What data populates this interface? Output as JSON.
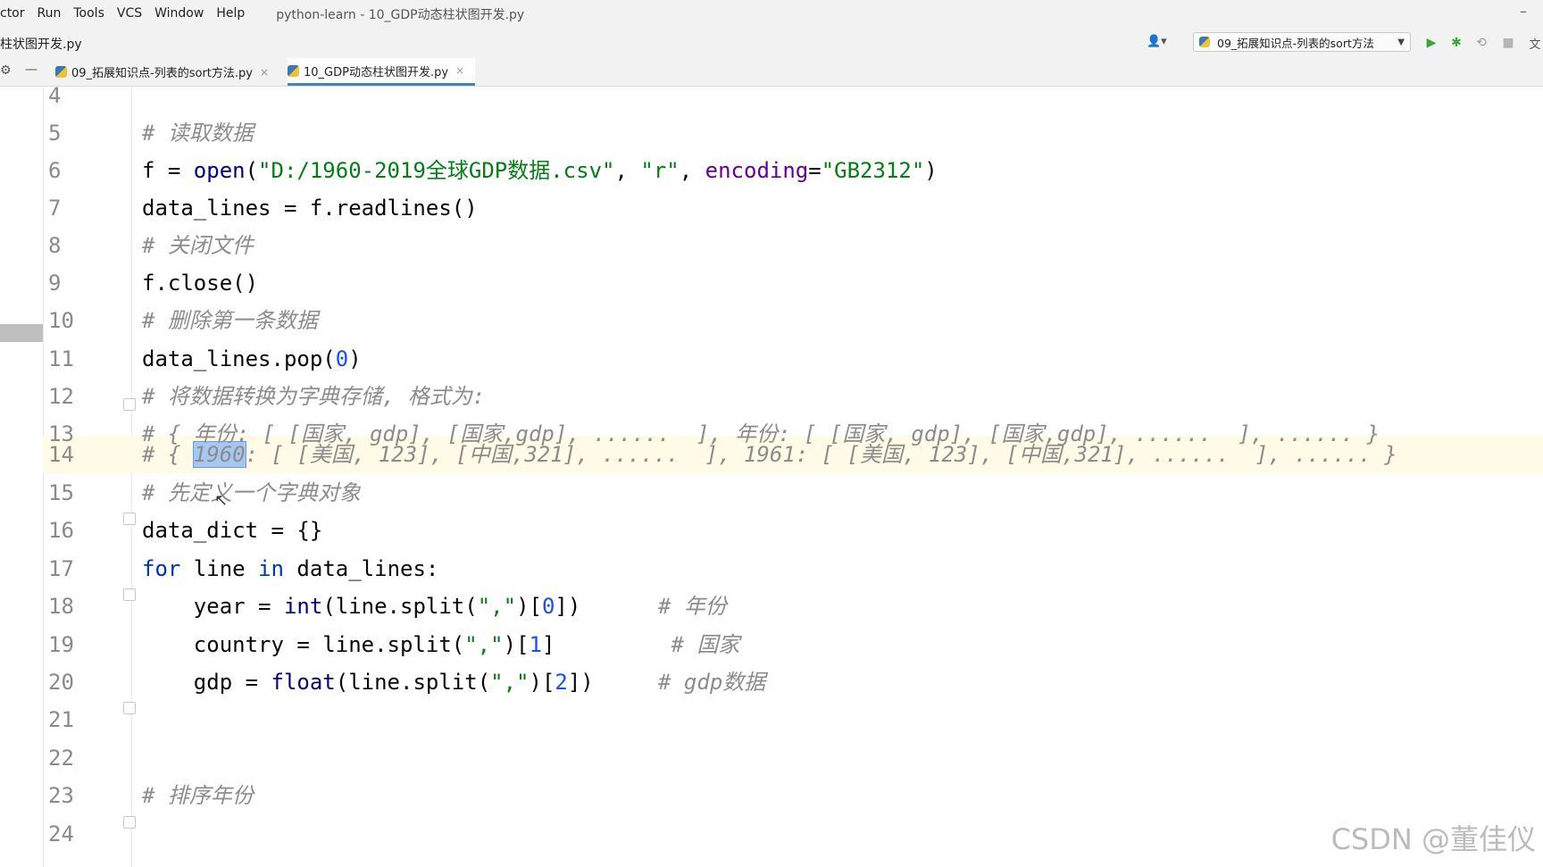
{
  "menu": {
    "items": [
      "ctor",
      "Run",
      "Tools",
      "VCS",
      "Window",
      "Help"
    ],
    "window_title": "python-learn - 10_GDP动态柱状图开发.py"
  },
  "nav": {
    "breadcrumb": "柱状图开发.py",
    "run_config": "09_拓展知识点-列表的sort方法"
  },
  "tabs": [
    {
      "label": "09_拓展知识点-列表的sort方法.py",
      "active": false
    },
    {
      "label": "10_GDP动态柱状图开发.py",
      "active": true
    }
  ],
  "editor": {
    "line_numbers": [
      "4",
      "5",
      "6",
      "7",
      "8",
      "9",
      "10",
      "11",
      "12",
      "13",
      "14",
      "15",
      "16",
      "17",
      "18",
      "19",
      "20",
      "21",
      "22",
      "23",
      "24"
    ],
    "current_line": "14",
    "selected_text": "1960",
    "lines": {
      "l5": {
        "comment": "# 读取数据"
      },
      "l6": {
        "var": "f = ",
        "fn": "open",
        "p1": "(",
        "s1": "\"D:/1960-2019全球GDP数据.csv\"",
        "c1": ", ",
        "s2": "\"r\"",
        "c2": ", ",
        "kw": "encoding",
        "eq": "=",
        "s3": "\"GB2312\"",
        "p2": ")"
      },
      "l7": {
        "code": "data_lines = f.readlines()"
      },
      "l8": {
        "comment": "# 关闭文件"
      },
      "l9": {
        "code": "f.close()"
      },
      "l10": {
        "comment": "# 删除第一条数据"
      },
      "l11": {
        "a": "data_lines.pop(",
        "n": "0",
        "b": ")"
      },
      "l12": {
        "comment": "# 将数据转换为字典存储, 格式为:"
      },
      "l13": {
        "comment": "# { 年份: [ [国家, gdp], [国家,gdp], ......  ], 年份: [ [国家, gdp], [国家,gdp], ......  ], ...... }"
      },
      "l14": {
        "pre": "# { ",
        "sel": "1960",
        "post": ": [ [美国, 123], [中国,321], ......  ], 1961: [ [美国, 123], [中国,321], ......  ], ...... }"
      },
      "l15": {
        "comment": "# 先定义一个字典对象"
      },
      "l16": {
        "code": "data_dict = {}"
      },
      "l17": {
        "kw1": "for",
        "a": " line ",
        "kw2": "in",
        "b": " data_lines:"
      },
      "l18": {
        "a": "    year = ",
        "fn": "int",
        "b": "(line.split(",
        "s": "\",\"",
        "c": ")[",
        "n": "0",
        "d": "])      ",
        "comment": "# 年份"
      },
      "l19": {
        "a": "    country = line.split(",
        "s": "\",\"",
        "c": ")[",
        "n": "1",
        "d": "]         ",
        "comment": "# 国家"
      },
      "l20": {
        "a": "    gdp = ",
        "fn": "float",
        "b": "(line.split(",
        "s": "\",\"",
        "c": ")[",
        "n": "2",
        "d": "])     ",
        "comment": "# gdp数据"
      },
      "l23": {
        "comment": "# 排序年份"
      }
    }
  },
  "watermark": "CSDN @董佳仪"
}
